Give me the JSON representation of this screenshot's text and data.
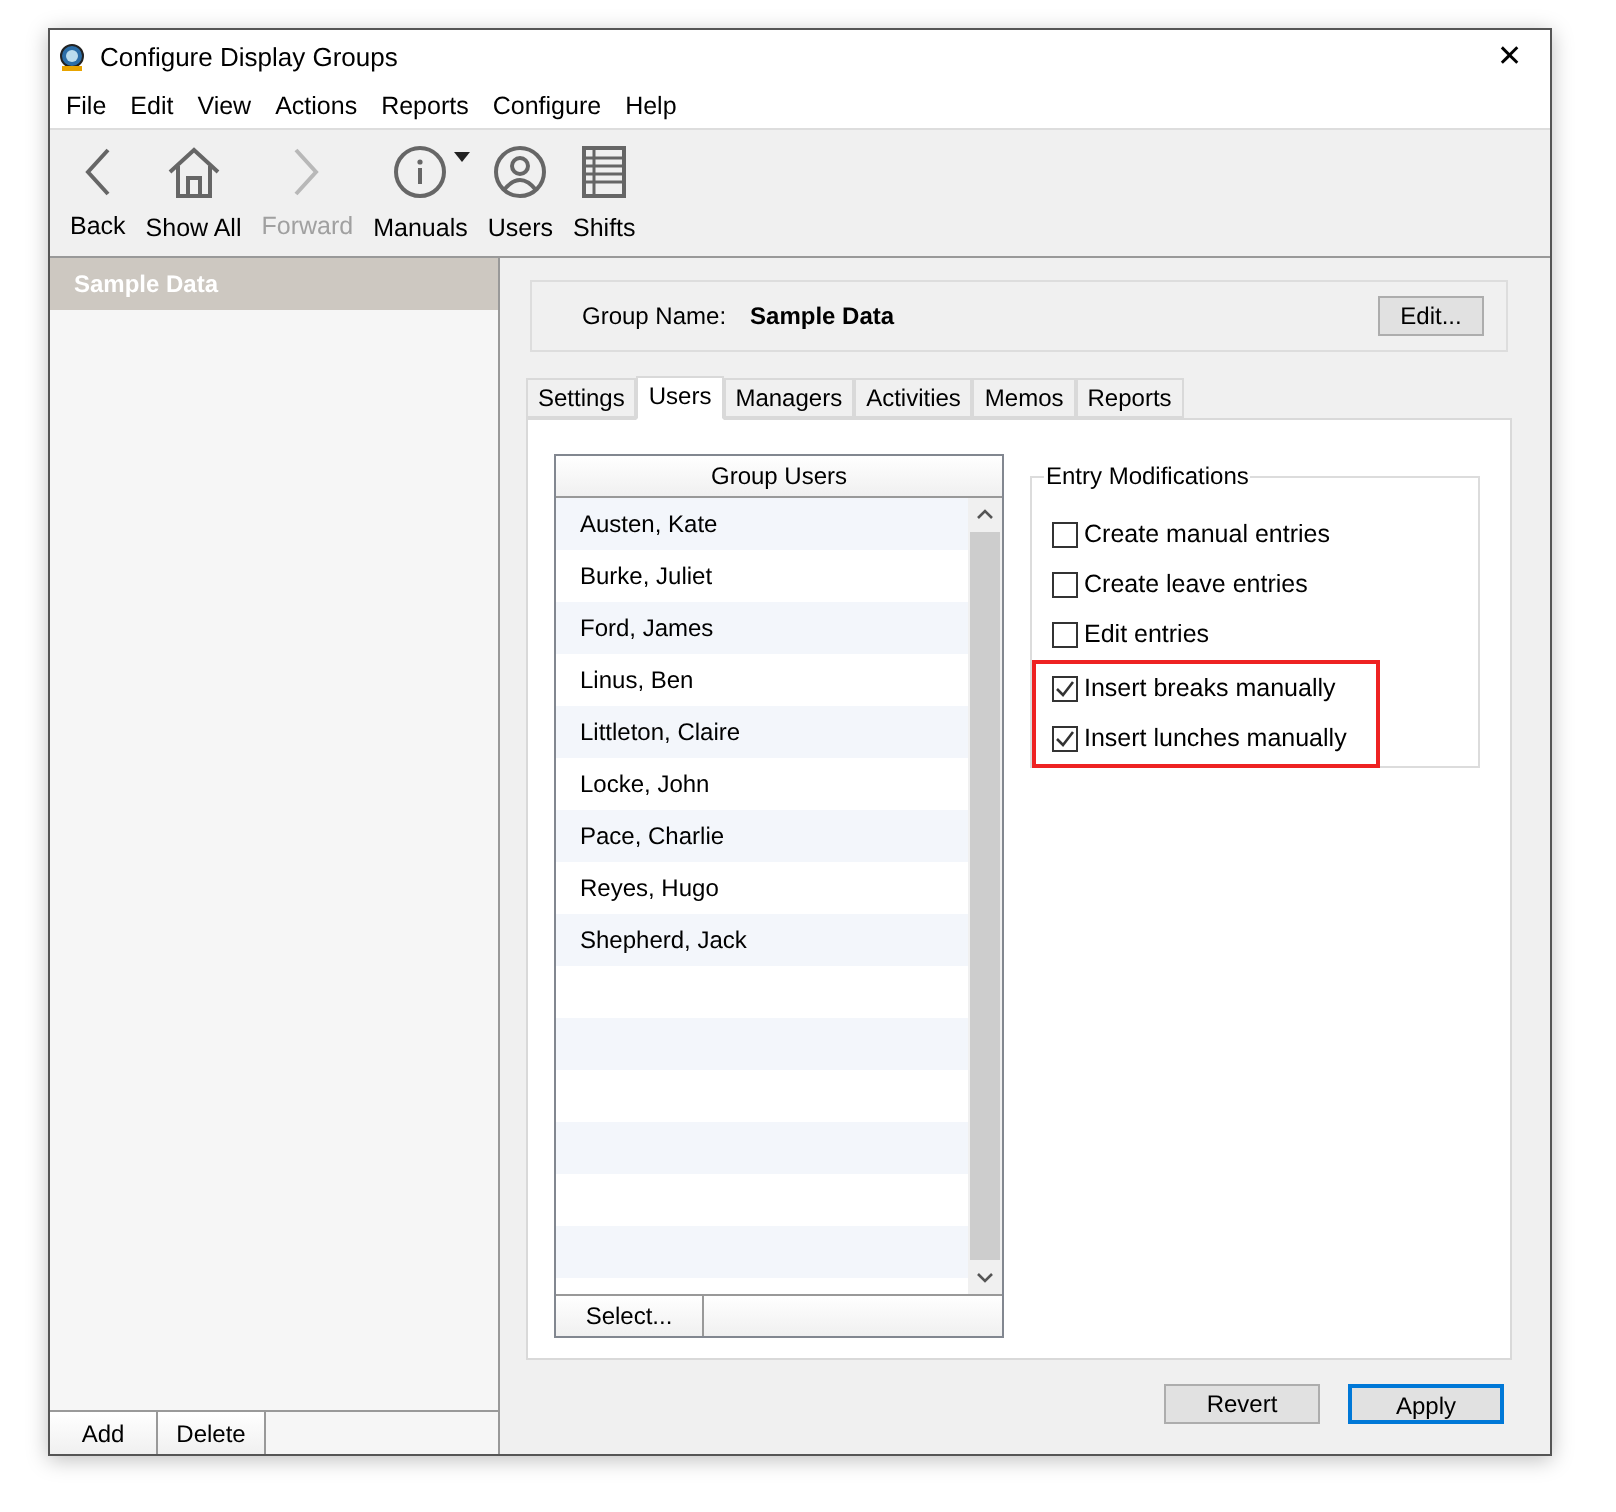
{
  "window": {
    "title": "Configure Display Groups",
    "close": "✕"
  },
  "menu": [
    "File",
    "Edit",
    "View",
    "Actions",
    "Reports",
    "Configure",
    "Help"
  ],
  "toolbar": [
    {
      "label": "Back",
      "kind": "back",
      "disabled": false
    },
    {
      "label": "Show All",
      "kind": "home",
      "disabled": false
    },
    {
      "label": "Forward",
      "kind": "forward",
      "disabled": true
    },
    {
      "label": "Manuals",
      "kind": "info",
      "disabled": false
    },
    {
      "label": "Users",
      "kind": "user",
      "disabled": false
    },
    {
      "label": "Shifts",
      "kind": "list",
      "disabled": false
    }
  ],
  "sidebar": {
    "items": [
      {
        "label": "Sample Data",
        "selected": true
      }
    ],
    "buttons": [
      "Add",
      "Delete"
    ]
  },
  "group_name": {
    "label": "Group Name:",
    "value": "Sample Data",
    "button": "Edit..."
  },
  "tabs": [
    {
      "label": "Settings",
      "selected": false
    },
    {
      "label": "Users",
      "selected": true
    },
    {
      "label": "Managers",
      "selected": false
    },
    {
      "label": "Activities",
      "selected": false
    },
    {
      "label": "Memos",
      "selected": false
    },
    {
      "label": "Reports",
      "selected": false
    }
  ],
  "group_users": {
    "header": "Group Users",
    "rows": [
      "Austen, Kate",
      "Burke, Juliet",
      "Ford, James",
      "Linus, Ben",
      "Littleton, Claire",
      "Locke, John",
      "Pace, Charlie",
      "Reyes, Hugo",
      "Shepherd, Jack"
    ],
    "button": "Select..."
  },
  "entry_modifications": {
    "title": "Entry Modifications",
    "options": [
      {
        "label": "Create manual entries",
        "checked": false,
        "highlighted": false
      },
      {
        "label": "Create leave entries",
        "checked": false,
        "highlighted": false
      },
      {
        "label": "Edit entries",
        "checked": false,
        "highlighted": false
      },
      {
        "label": "Insert breaks manually",
        "checked": true,
        "highlighted": true
      },
      {
        "label": "Insert lunches manually",
        "checked": true,
        "highlighted": true
      }
    ]
  },
  "buttons": [
    {
      "label": "Revert",
      "default": false
    },
    {
      "label": "Apply",
      "default": true
    }
  ]
}
